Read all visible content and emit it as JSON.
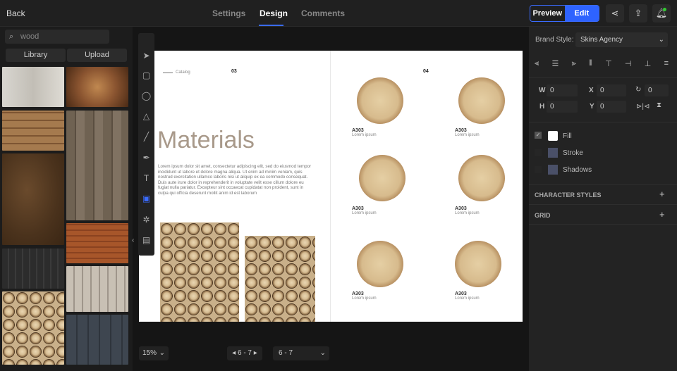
{
  "header": {
    "back": "Back",
    "tabs": [
      "Settings",
      "Design",
      "Comments"
    ],
    "preview": "Preview",
    "edit": "Edit"
  },
  "left": {
    "search_value": "wood",
    "library": "Library",
    "upload": "Upload"
  },
  "page": {
    "catalog": "Catalog",
    "left_num": "03",
    "right_num": "04",
    "title": "Materials",
    "body": "Lorem ipsum dolor sit amet, consectetur adipiscing elit, sed do eiusmod tempor incididunt ut labore et dolore magna aliqua. Ut enim ad minim veniam, quis nostrud exercitation ullamco laboris nisi ut aliquip ex ea commodo consequat. Duis aute irure dolor in reprehenderit in voluptate velit esse cillum dolore eu fugiat nulla pariatur. Excepteur sint occaecat cupidatat non proident, sunt in culpa qui officia deserunt mollit anim id est laborum",
    "products": [
      {
        "code": "A303",
        "desc": "Lorem ipsum"
      },
      {
        "code": "A303",
        "desc": "Lorem ipsum"
      },
      {
        "code": "A303",
        "desc": "Lorem ipsum"
      },
      {
        "code": "A303",
        "desc": "Lorem ipsum"
      },
      {
        "code": "A303",
        "desc": "Lorem ipsum"
      },
      {
        "code": "A303",
        "desc": "Lorem ipsum"
      }
    ]
  },
  "right": {
    "brand_label": "Brand Style:",
    "brand_value": "Skins Agency",
    "w_label": "W",
    "w": "0",
    "x_label": "X",
    "x": "0",
    "rot": "0",
    "h_label": "H",
    "h": "0",
    "y_label": "Y",
    "y": "0",
    "fill": "Fill",
    "stroke": "Stroke",
    "shadows": "Shadows",
    "char_styles": "CHARACTER STYLES",
    "grid": "GRID"
  },
  "footer": {
    "zoom": "15%",
    "pages": "6 - 7",
    "page_select": "6 - 7"
  },
  "colors": {
    "accent": "#2e63ff"
  }
}
